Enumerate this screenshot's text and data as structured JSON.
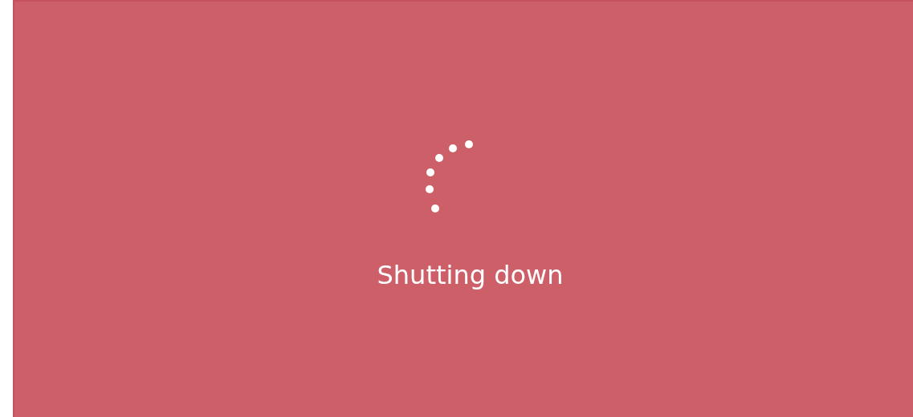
{
  "status": {
    "message": "Shutting down"
  }
}
